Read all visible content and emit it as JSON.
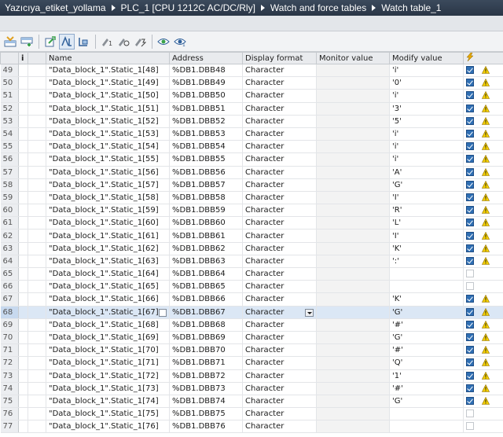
{
  "breadcrumb": [
    "Yazıcıya_etiket_yollama",
    "PLC_1 [CPU 1212C AC/DC/Rly]",
    "Watch and force tables",
    "Watch table_1"
  ],
  "columns": {
    "info": "i",
    "name": "Name",
    "address": "Address",
    "format": "Display format",
    "monitor": "Monitor value",
    "modify": "Modify value"
  },
  "toolbar": [
    "insert-row-icon",
    "add-row-icon",
    "update-icon",
    "display-format-icon",
    "expand-icon",
    "modify-now-icon",
    "modify-trigger-icon",
    "monitor-all-icon",
    "monitor-once-icon"
  ],
  "rows": [
    {
      "n": "49",
      "name": "\"Data_block_1\".Static_1[48]",
      "address": "%DB1.DBB48",
      "format": "Character",
      "modify": "'i'",
      "checked": true,
      "warn": true
    },
    {
      "n": "50",
      "name": "\"Data_block_1\".Static_1[49]",
      "address": "%DB1.DBB49",
      "format": "Character",
      "modify": "'0'",
      "checked": true,
      "warn": true
    },
    {
      "n": "51",
      "name": "\"Data_block_1\".Static_1[50]",
      "address": "%DB1.DBB50",
      "format": "Character",
      "modify": "'i'",
      "checked": true,
      "warn": true
    },
    {
      "n": "52",
      "name": "\"Data_block_1\".Static_1[51]",
      "address": "%DB1.DBB51",
      "format": "Character",
      "modify": "'3'",
      "checked": true,
      "warn": true
    },
    {
      "n": "53",
      "name": "\"Data_block_1\".Static_1[52]",
      "address": "%DB1.DBB52",
      "format": "Character",
      "modify": "'5'",
      "checked": true,
      "warn": true
    },
    {
      "n": "54",
      "name": "\"Data_block_1\".Static_1[53]",
      "address": "%DB1.DBB53",
      "format": "Character",
      "modify": "'i'",
      "checked": true,
      "warn": true
    },
    {
      "n": "55",
      "name": "\"Data_block_1\".Static_1[54]",
      "address": "%DB1.DBB54",
      "format": "Character",
      "modify": "'i'",
      "checked": true,
      "warn": true
    },
    {
      "n": "56",
      "name": "\"Data_block_1\".Static_1[55]",
      "address": "%DB1.DBB55",
      "format": "Character",
      "modify": "'i'",
      "checked": true,
      "warn": true
    },
    {
      "n": "57",
      "name": "\"Data_block_1\".Static_1[56]",
      "address": "%DB1.DBB56",
      "format": "Character",
      "modify": "'A'",
      "checked": true,
      "warn": true
    },
    {
      "n": "58",
      "name": "\"Data_block_1\".Static_1[57]",
      "address": "%DB1.DBB57",
      "format": "Character",
      "modify": "'G'",
      "checked": true,
      "warn": true
    },
    {
      "n": "59",
      "name": "\"Data_block_1\".Static_1[58]",
      "address": "%DB1.DBB58",
      "format": "Character",
      "modify": "'I'",
      "checked": true,
      "warn": true
    },
    {
      "n": "60",
      "name": "\"Data_block_1\".Static_1[59]",
      "address": "%DB1.DBB59",
      "format": "Character",
      "modify": "'R'",
      "checked": true,
      "warn": true
    },
    {
      "n": "61",
      "name": "\"Data_block_1\".Static_1[60]",
      "address": "%DB1.DBB60",
      "format": "Character",
      "modify": "'L'",
      "checked": true,
      "warn": true
    },
    {
      "n": "62",
      "name": "\"Data_block_1\".Static_1[61]",
      "address": "%DB1.DBB61",
      "format": "Character",
      "modify": "'I'",
      "checked": true,
      "warn": true
    },
    {
      "n": "63",
      "name": "\"Data_block_1\".Static_1[62]",
      "address": "%DB1.DBB62",
      "format": "Character",
      "modify": "'K'",
      "checked": true,
      "warn": true
    },
    {
      "n": "64",
      "name": "\"Data_block_1\".Static_1[63]",
      "address": "%DB1.DBB63",
      "format": "Character",
      "modify": "':'",
      "checked": true,
      "warn": true
    },
    {
      "n": "65",
      "name": "\"Data_block_1\".Static_1[64]",
      "address": "%DB1.DBB64",
      "format": "Character",
      "modify": "",
      "checked": false,
      "warn": false
    },
    {
      "n": "66",
      "name": "\"Data_block_1\".Static_1[65]",
      "address": "%DB1.DBB65",
      "format": "Character",
      "modify": "",
      "checked": false,
      "warn": false
    },
    {
      "n": "67",
      "name": "\"Data_block_1\".Static_1[66]",
      "address": "%DB1.DBB66",
      "format": "Character",
      "modify": "'K'",
      "checked": true,
      "warn": true
    },
    {
      "n": "68",
      "name": "\"Data_block_1\".Static_1[67]",
      "address": "%DB1.DBB67",
      "format": "Character",
      "modify": "'G'",
      "checked": true,
      "warn": true,
      "selected": true
    },
    {
      "n": "69",
      "name": "\"Data_block_1\".Static_1[68]",
      "address": "%DB1.DBB68",
      "format": "Character",
      "modify": "'#'",
      "checked": true,
      "warn": true
    },
    {
      "n": "70",
      "name": "\"Data_block_1\".Static_1[69]",
      "address": "%DB1.DBB69",
      "format": "Character",
      "modify": "'G'",
      "checked": true,
      "warn": true
    },
    {
      "n": "71",
      "name": "\"Data_block_1\".Static_1[70]",
      "address": "%DB1.DBB70",
      "format": "Character",
      "modify": "'#'",
      "checked": true,
      "warn": true
    },
    {
      "n": "72",
      "name": "\"Data_block_1\".Static_1[71]",
      "address": "%DB1.DBB71",
      "format": "Character",
      "modify": "'Q'",
      "checked": true,
      "warn": true
    },
    {
      "n": "73",
      "name": "\"Data_block_1\".Static_1[72]",
      "address": "%DB1.DBB72",
      "format": "Character",
      "modify": "'1'",
      "checked": true,
      "warn": true
    },
    {
      "n": "74",
      "name": "\"Data_block_1\".Static_1[73]",
      "address": "%DB1.DBB73",
      "format": "Character",
      "modify": "'#'",
      "checked": true,
      "warn": true
    },
    {
      "n": "75",
      "name": "\"Data_block_1\".Static_1[74]",
      "address": "%DB1.DBB74",
      "format": "Character",
      "modify": "'G'",
      "checked": true,
      "warn": true
    },
    {
      "n": "76",
      "name": "\"Data_block_1\".Static_1[75]",
      "address": "%DB1.DBB75",
      "format": "Character",
      "modify": "",
      "checked": false,
      "warn": false
    },
    {
      "n": "77",
      "name": "\"Data_block_1\".Static_1[76]",
      "address": "%DB1.DBB76",
      "format": "Character",
      "modify": "",
      "checked": false,
      "warn": false
    }
  ]
}
